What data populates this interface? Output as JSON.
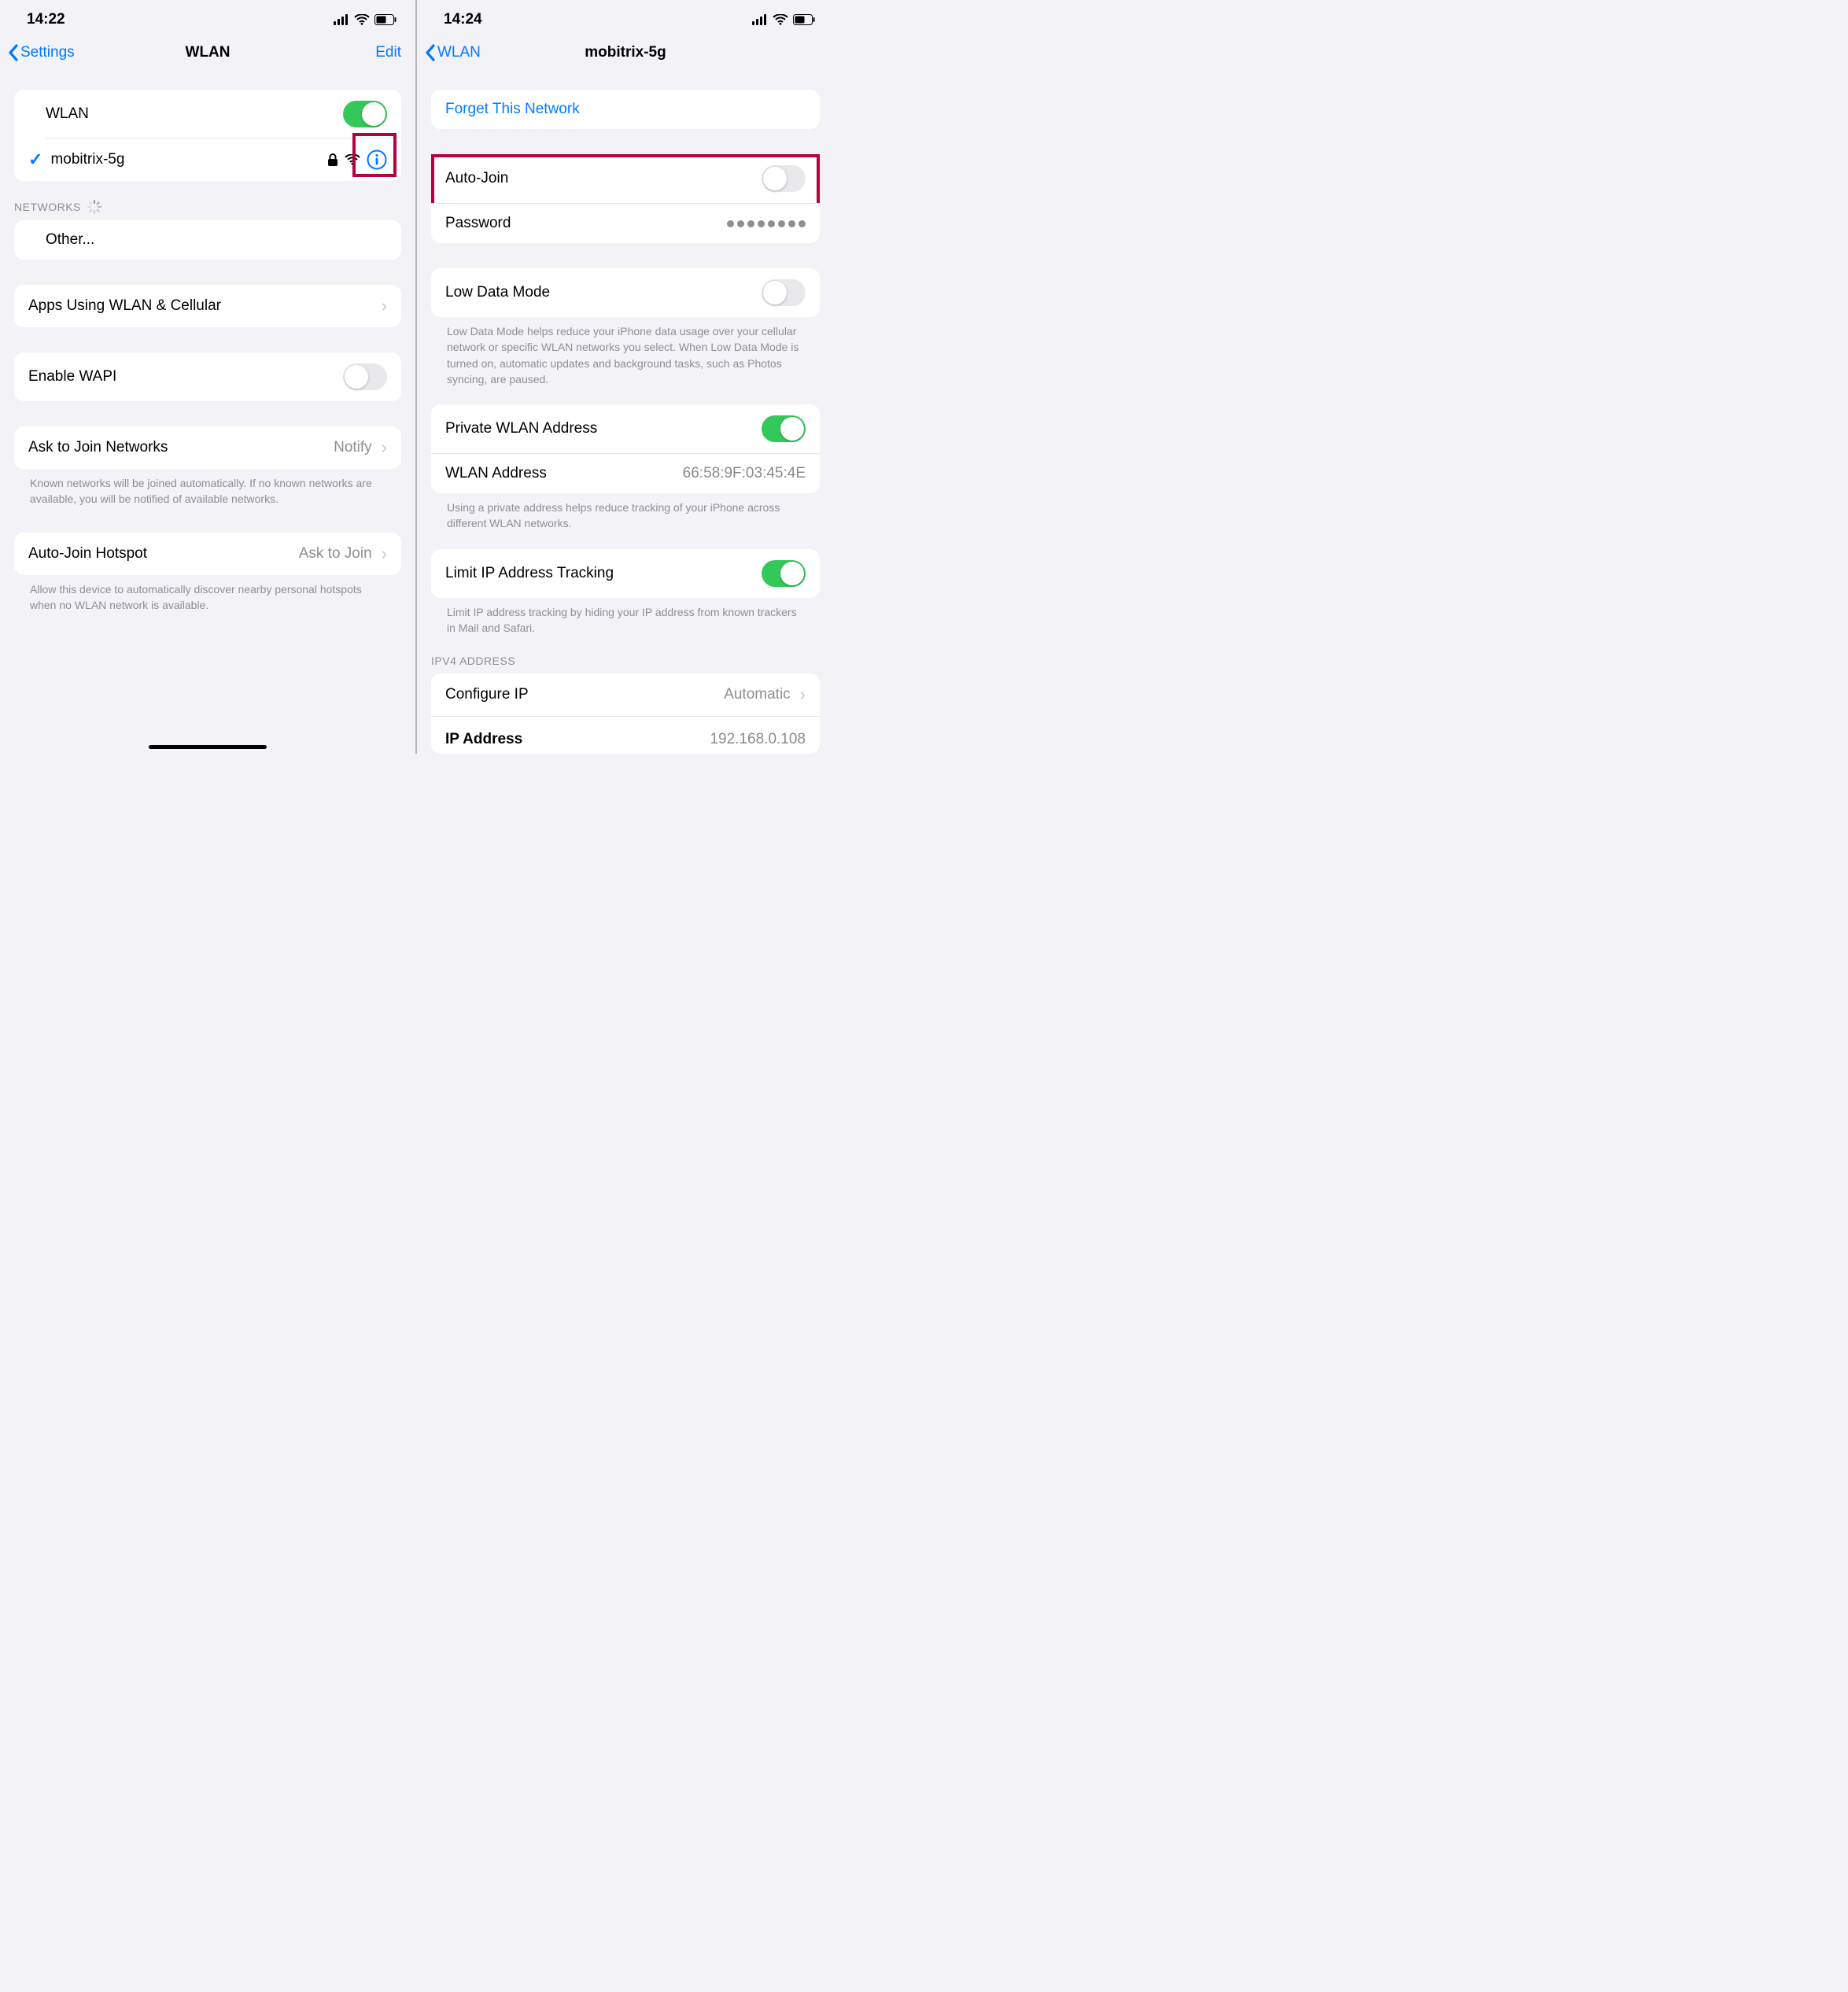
{
  "left": {
    "time": "14:22",
    "nav": {
      "back": "Settings",
      "title": "WLAN",
      "edit": "Edit"
    },
    "wlan_row": {
      "label": "WLAN",
      "on": true
    },
    "connected": {
      "name": "mobitrix-5g"
    },
    "networks_header": "NETWORKS",
    "other": "Other...",
    "apps_using": "Apps Using WLAN & Cellular",
    "enable_wapi": "Enable WAPI",
    "ask_join": {
      "label": "Ask to Join Networks",
      "value": "Notify"
    },
    "ask_join_footer": "Known networks will be joined automatically. If no known networks are available, you will be notified of available networks.",
    "auto_hotspot": {
      "label": "Auto-Join Hotspot",
      "value": "Ask to Join"
    },
    "auto_hotspot_footer": "Allow this device to automatically discover nearby personal hotspots when no WLAN network is available."
  },
  "right": {
    "time": "14:24",
    "nav": {
      "back": "WLAN",
      "title": "mobitrix-5g"
    },
    "forget": "Forget This Network",
    "auto_join": "Auto-Join",
    "password": "Password",
    "low_data": "Low Data Mode",
    "low_data_footer": "Low Data Mode helps reduce your iPhone data usage over your cellular network or specific WLAN networks you select. When Low Data Mode is turned on, automatic updates and background tasks, such as Photos syncing, are paused.",
    "private_addr": "Private WLAN Address",
    "wlan_addr_label": "WLAN Address",
    "wlan_addr_value": "66:58:9F:03:45:4E",
    "private_footer": "Using a private address helps reduce tracking of your iPhone across different WLAN networks.",
    "limit_ip": "Limit IP Address Tracking",
    "limit_ip_footer": "Limit IP address tracking by hiding your IP address from known trackers in Mail and Safari.",
    "ipv4_header": "IPV4 ADDRESS",
    "configure_ip": {
      "label": "Configure IP",
      "value": "Automatic"
    },
    "ip_addr": {
      "label": "IP Address",
      "value": "192.168.0.108"
    }
  }
}
